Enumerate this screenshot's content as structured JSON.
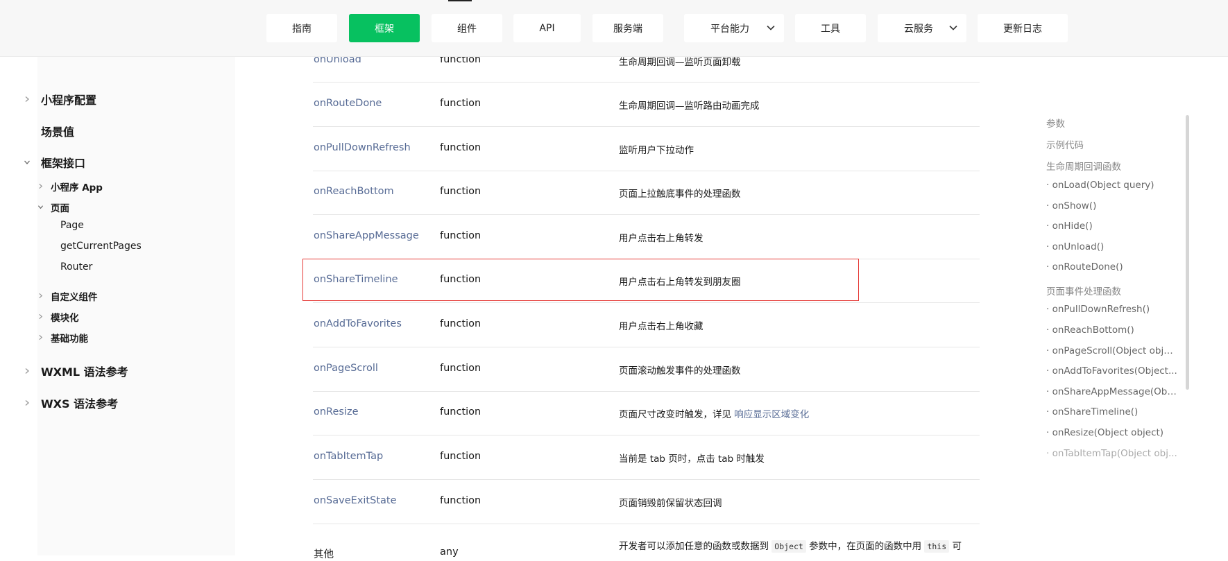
{
  "nav": {
    "items": [
      {
        "label": "指南"
      },
      {
        "label": "框架",
        "active": true
      },
      {
        "label": "组件"
      },
      {
        "label": "API"
      },
      {
        "label": "服务端"
      },
      {
        "label": "平台能力",
        "dropdown": true
      },
      {
        "label": "工具"
      },
      {
        "label": "云服务",
        "dropdown": true
      },
      {
        "label": "更新日志"
      }
    ],
    "accent_color": "#07c160"
  },
  "sidebar": {
    "items": [
      {
        "label": "小程序配置",
        "chevron": "chevron-right-icon"
      },
      {
        "label": "场景值"
      },
      {
        "label": "框架接口",
        "chevron": "chevron-down-icon"
      },
      {
        "label": "小程序 App",
        "chevron": "chevron-right-icon"
      },
      {
        "label": "页面",
        "chevron": "chevron-down-icon"
      },
      {
        "label": "Page"
      },
      {
        "label": "getCurrentPages"
      },
      {
        "label": "Router"
      },
      {
        "label": "自定义组件",
        "chevron": "chevron-right-icon"
      },
      {
        "label": "模块化",
        "chevron": "chevron-right-icon"
      },
      {
        "label": "基础功能",
        "chevron": "chevron-right-icon"
      },
      {
        "label": "WXML 语法参考",
        "chevron": "chevron-right-icon"
      },
      {
        "label": "WXS 语法参考",
        "chevron": "chevron-right-icon"
      }
    ]
  },
  "table": {
    "rows": [
      {
        "name": "onUnload",
        "type": "function",
        "desc": "生命周期回调—监听页面卸载"
      },
      {
        "name": "onRouteDone",
        "type": "function",
        "desc": "生命周期回调—监听路由动画完成"
      },
      {
        "name": "onPullDownRefresh",
        "type": "function",
        "desc": "监听用户下拉动作"
      },
      {
        "name": "onReachBottom",
        "type": "function",
        "desc": "页面上拉触底事件的处理函数"
      },
      {
        "name": "onShareAppMessage",
        "type": "function",
        "desc": "用户点击右上角转发"
      },
      {
        "name": "onShareTimeline",
        "type": "function",
        "desc": "用户点击右上角转发到朋友圈"
      },
      {
        "name": "onAddToFavorites",
        "type": "function",
        "desc": "用户点击右上角收藏"
      },
      {
        "name": "onPageScroll",
        "type": "function",
        "desc": "页面滚动触发事件的处理函数"
      },
      {
        "name": "onResize",
        "type": "function",
        "desc": "页面尺寸改变时触发，详见",
        "link": "响应显示区域变化"
      },
      {
        "name": "onTabItemTap",
        "type": "function",
        "desc": "当前是 tab 页时，点击 tab 时触发"
      },
      {
        "name": "onSaveExitState",
        "type": "function",
        "desc": "页面销毁前保留状态回调"
      },
      {
        "name": "其他",
        "type": "any",
        "desc_parts": [
          "开发者可以添加任意的函数或数据到",
          "Object",
          "参数中，在页面的函数中用",
          "this",
          "可"
        ]
      }
    ],
    "highlight_color": "#e53935"
  },
  "toc": {
    "items": [
      {
        "label": "参数",
        "section": true
      },
      {
        "label": "示例代码",
        "section": true
      },
      {
        "label": "生命周期回调函数",
        "section": true
      },
      {
        "label": "· onLoad(Object query)"
      },
      {
        "label": "· onShow()"
      },
      {
        "label": "· onHide()"
      },
      {
        "label": "· onUnload()"
      },
      {
        "label": "· onRouteDone()"
      },
      {
        "label": "页面事件处理函数",
        "section": true
      },
      {
        "label": "· onPullDownRefresh()"
      },
      {
        "label": "· onReachBottom()"
      },
      {
        "label": "· onPageScroll(Object obje..."
      },
      {
        "label": "· onAddToFavorites(Object..."
      },
      {
        "label": "· onShareAppMessage(Obj..."
      },
      {
        "label": "· onShareTimeline()"
      },
      {
        "label": "· onResize(Object object)"
      },
      {
        "label": "· onTabItemTap(Object obj..."
      }
    ]
  }
}
